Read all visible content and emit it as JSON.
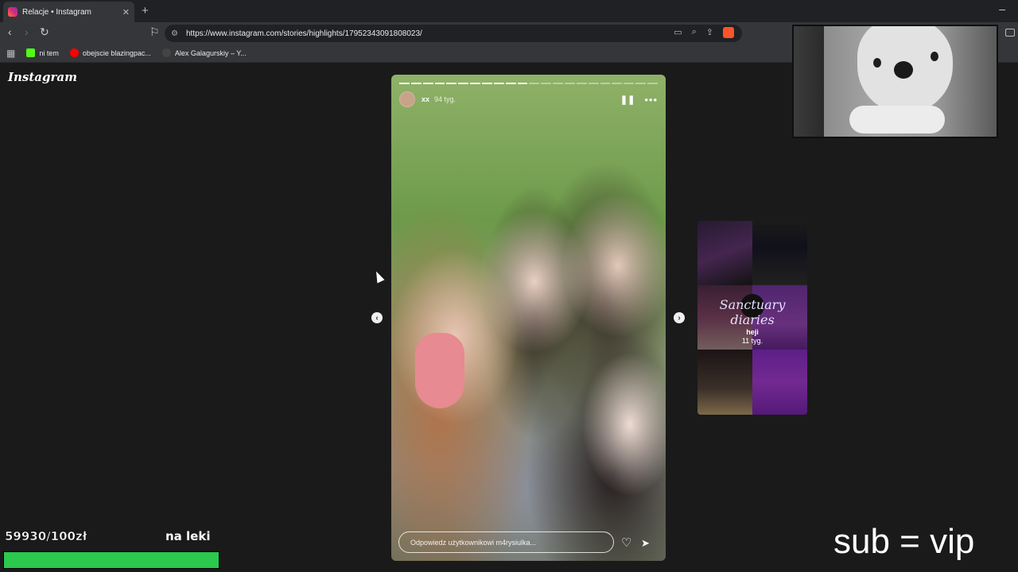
{
  "browser": {
    "tab_title": "Relacje • Instagram",
    "tab_close": "✕",
    "new_tab": "+",
    "minimize": "–",
    "url": "https://www.instagram.com/stories/highlights/17952343091808023/",
    "back_icon": "‹",
    "forward_icon": "›",
    "reload_icon": "↻",
    "bookmark_icon": "⚐",
    "cast_icon": "▭",
    "zoom_icon": "⌕",
    "share_icon": "⇪"
  },
  "bookmarks": [
    {
      "label": "ni tem",
      "color": "#53fc18"
    },
    {
      "label": "obejscie blazingpac...",
      "color": "#ff0000"
    },
    {
      "label": "Alex Galagurskiy – Y...",
      "color": "#444444"
    }
  ],
  "instagram": {
    "logo": "Instagram",
    "story": {
      "username": "xx",
      "time": "94 tyg.",
      "pause_icon": "❚❚",
      "more_icon": "•••",
      "reply_placeholder": "Odpowiedz użytkownikowi m4rysiulka...",
      "heart_icon": "♡",
      "send_icon": "➤",
      "progress": {
        "segments": 22,
        "completed": 11
      }
    },
    "prev_arrow": "‹",
    "next_arrow": "›",
    "next_preview": {
      "title": "Sanctuary diaries",
      "name": "heji",
      "time": "11 tyg."
    }
  },
  "stream_overlay": {
    "goal_amount": "59930/100zł",
    "goal_label": "na leki",
    "goal_fill_fraction": 1.0,
    "goal_color": "#2bc94e",
    "caption": "sub = vip"
  }
}
